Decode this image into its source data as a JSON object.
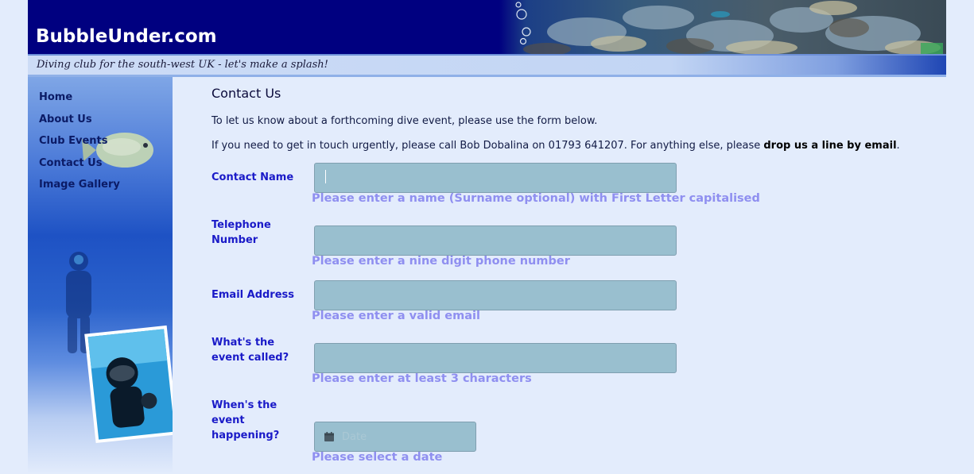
{
  "header": {
    "site_name": "BubbleUnder.com",
    "tagline": "Diving club for the south-west UK - let's make a splash!"
  },
  "nav": {
    "items": [
      {
        "label": "Home"
      },
      {
        "label": "About Us"
      },
      {
        "label": "Club Events"
      },
      {
        "label": "Contact Us"
      },
      {
        "label": "Image Gallery"
      }
    ]
  },
  "main": {
    "title": "Contact Us",
    "intro": "To let us know about a forthcoming dive event, please use the form below.",
    "urgent_prefix": "If you need to get in touch urgently, please call Bob Dobalina on 01793 641207. For anything else, please ",
    "urgent_link": "drop us a line by email",
    "urgent_suffix": "."
  },
  "form": {
    "name": {
      "label": "Contact Name",
      "value": "",
      "hint": "Please enter a name (Surname optional) with First Letter capitalised"
    },
    "phone": {
      "label": "Telephone Number",
      "value": "",
      "hint": "Please enter a nine digit phone number"
    },
    "email": {
      "label": "Email Address",
      "value": "",
      "hint": "Please enter a valid email"
    },
    "event_name": {
      "label": "What's the event called?",
      "value": "",
      "hint": "Please enter at least 3 characters"
    },
    "event_date": {
      "label": "When's the event happening?",
      "placeholder": "Date",
      "value": "",
      "icon": "calendar-icon",
      "hint": "Please select a date"
    }
  },
  "colors": {
    "header_bg": "#000080",
    "page_bg": "#e3ecfc",
    "label": "#1a1ac8",
    "hint": "#8f8ff0",
    "field_bg": "#99bfcf",
    "nav_text": "#0b1b66"
  }
}
